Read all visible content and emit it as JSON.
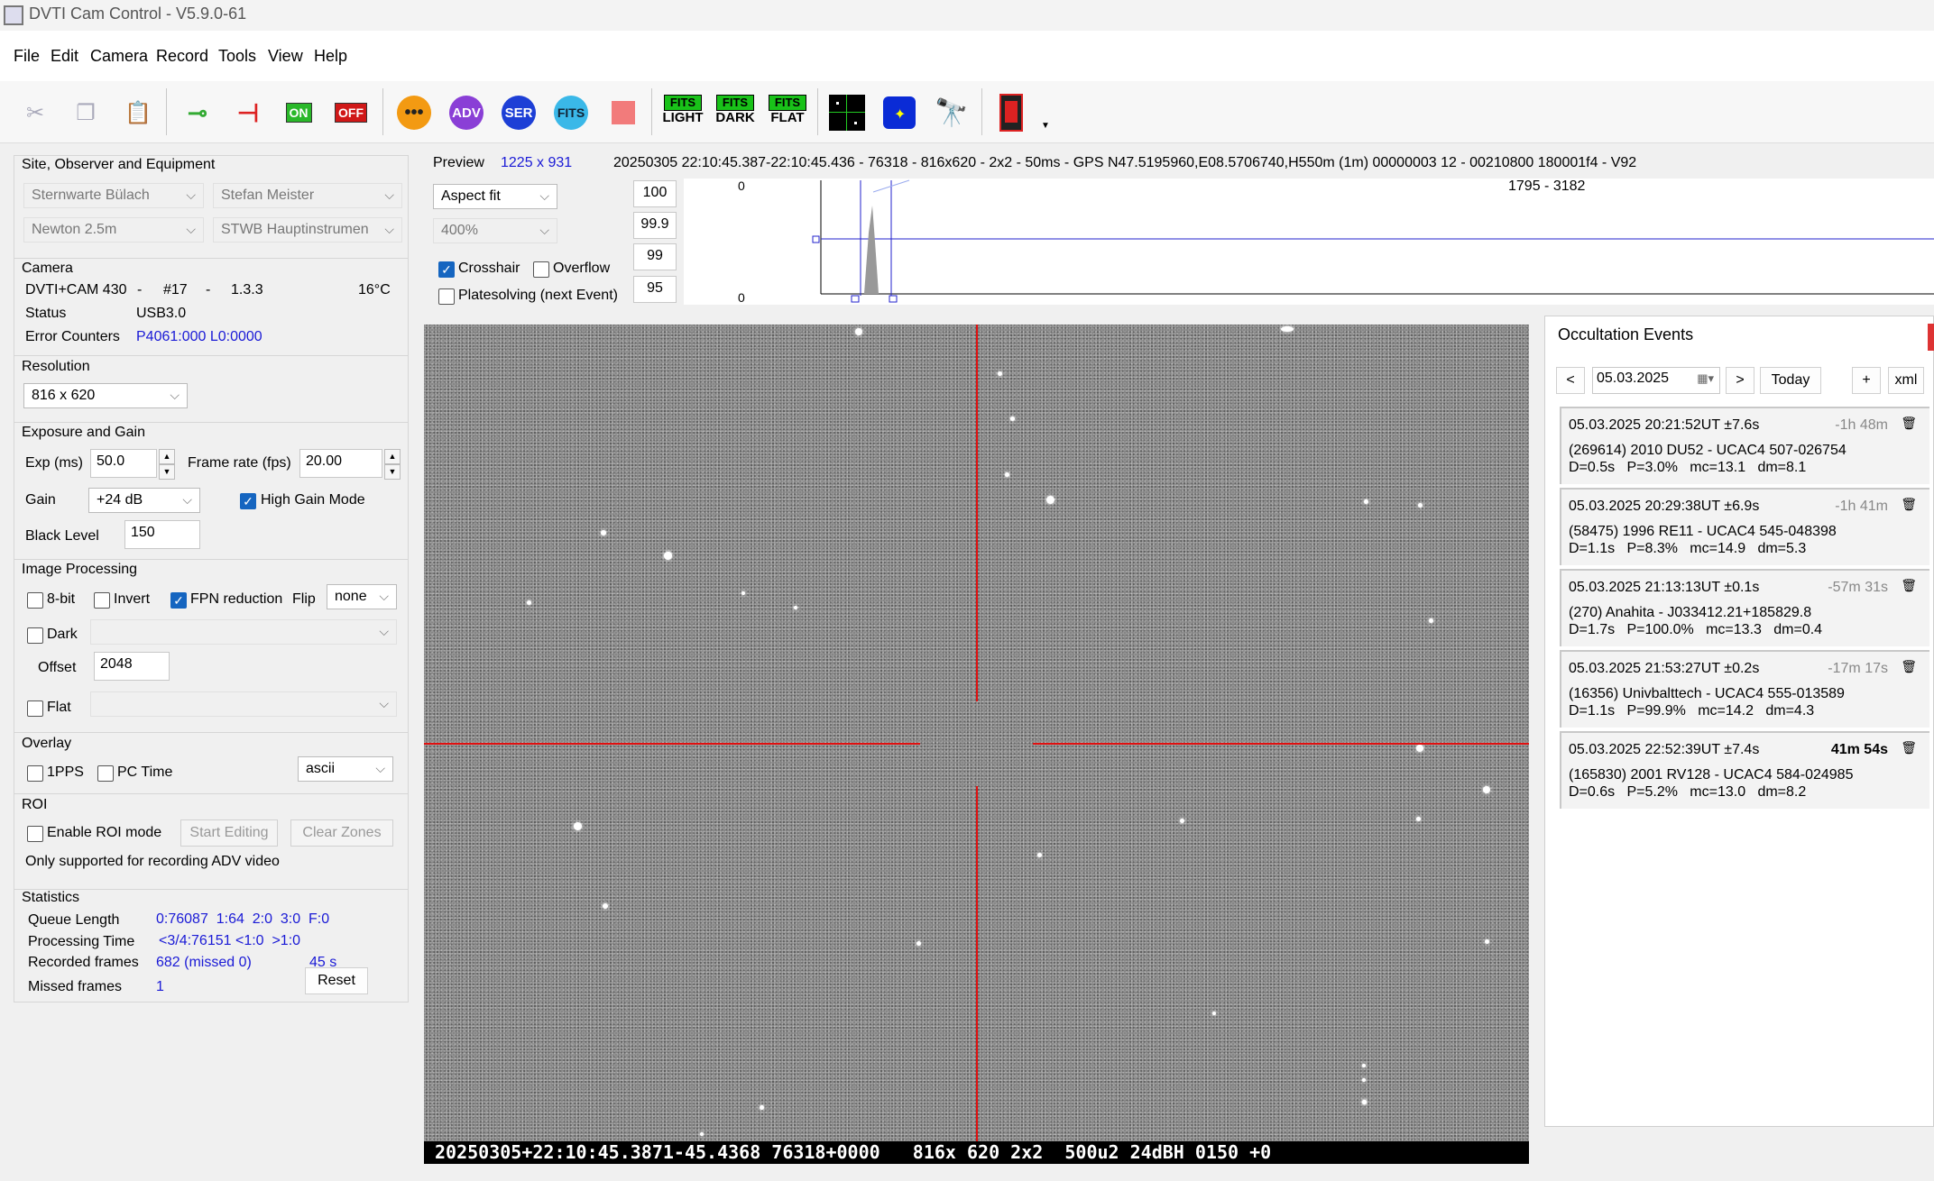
{
  "window": {
    "title": "DVTI Cam Control - V5.9.0-61"
  },
  "menu": [
    "File",
    "Edit",
    "Camera",
    "Record",
    "Tools",
    "View",
    "Help"
  ],
  "toolbar": {
    "on_label": "ON",
    "off_label": "OFF",
    "adv_label": "ADV",
    "ser_label": "SER",
    "fits_label": "FITS",
    "fits_light": "LIGHT",
    "fits_dark": "DARK",
    "fits_flat": "FLAT",
    "fits_badge": "FITS"
  },
  "site": {
    "title": "Site, Observer and Equipment",
    "site": "Sternwarte Bülach",
    "observer": "Stefan Meister",
    "telescope": "Newton 2.5m",
    "instrument": "STWB Hauptinstrumen"
  },
  "camera": {
    "title": "Camera",
    "model": "DVTI+CAM 430",
    "sep1": "-",
    "number": "#17",
    "sep2": "-",
    "version": "1.3.3",
    "temp": "16°C",
    "status_label": "Status",
    "status_value": "USB3.0",
    "errors_label": "Error Counters",
    "errors_value": "P4061:000 L0:0000"
  },
  "resolution": {
    "title": "Resolution",
    "value": "816 x 620"
  },
  "exposure": {
    "title": "Exposure and Gain",
    "exp_label": "Exp (ms)",
    "exp_value": "50.0",
    "fps_label": "Frame rate (fps)",
    "fps_value": "20.00",
    "gain_label": "Gain",
    "gain_value": "+24 dB",
    "high_gain_label": "High Gain Mode",
    "black_label": "Black Level",
    "black_value": "150"
  },
  "processing": {
    "title": "Image Processing",
    "bit8": "8-bit",
    "invert": "Invert",
    "fpn": "FPN reduction",
    "flip_label": "Flip",
    "flip_value": "none",
    "dark": "Dark",
    "offset_label": "Offset",
    "offset_value": "2048",
    "flat": "Flat"
  },
  "overlay": {
    "title": "Overlay",
    "pps": "1PPS",
    "pctime": "PC Time",
    "mode": "ascii"
  },
  "roi": {
    "title": "ROI",
    "enable": "Enable ROI mode",
    "start": "Start Editing",
    "clear": "Clear Zones",
    "note": "Only supported for recording ADV video"
  },
  "stats": {
    "title": "Statistics",
    "queue_label": "Queue Length",
    "queue_value": "0:76087  1:64  2:0  3:0  F:0",
    "proc_label": "Processing Time",
    "proc_value": "<3/4:76151 <1:0  >1:0",
    "rec_label": "Recorded frames",
    "rec_value": "682 (missed 0)",
    "rec_time": "45 s",
    "missed_label": "Missed frames",
    "missed_value": "1",
    "reset": "Reset"
  },
  "preview": {
    "label": "Preview",
    "size": "1225 x 931",
    "info": "20250305 22:10:45.387-22:10:45.436 - 76318 - 816x620 - 2x2 - 50ms - GPS N47.5195960,E08.5706740,H550m (1m) 00000003 12 - 00210800 180001f4 - V92",
    "fit": "Aspect fit",
    "zoom": "400%",
    "crosshair": "Crosshair",
    "overflow": "Overflow",
    "platesolving": "Platesolving (next Event)",
    "vals": [
      "100",
      "99.9",
      "99",
      "95"
    ],
    "histo_top": "0",
    "histo_bottom": "0",
    "histo_range": "1795 - 3182"
  },
  "overlay_text": "20250305+22:10:45.3871-45.4368 76318+0000   816x 620 2x2  500u2 24dBH 0150 +0",
  "occultation": {
    "title": "Occultation Events",
    "prev": "<",
    "date": "05.03.2025",
    "next": ">",
    "today": "Today",
    "add": "+",
    "xml": "xml",
    "events": [
      {
        "time": "05.03.2025 20:21:52UT ±7.6s",
        "rel": "-1h 48m",
        "obj": "(269614) 2010 DU52 - UCAC4 507-026754",
        "params": "D=0.5s   P=3.0%   mc=13.1   dm=8.1"
      },
      {
        "time": "05.03.2025 20:29:38UT ±6.9s",
        "rel": "-1h 41m",
        "obj": "(58475) 1996 RE11 - UCAC4 545-048398",
        "params": "D=1.1s   P=8.3%   mc=14.9   dm=5.3"
      },
      {
        "time": "05.03.2025 21:13:13UT ±0.1s",
        "rel": "-57m 31s",
        "obj": "(270) Anahita - J033412.21+185829.8",
        "params": "D=1.7s   P=100.0%   mc=13.3   dm=0.4"
      },
      {
        "time": "05.03.2025 21:53:27UT ±0.2s",
        "rel": "-17m 17s",
        "obj": "(16356) Univbalttech - UCAC4 555-013589",
        "params": "D=1.1s   P=99.9%   mc=14.2   dm=4.3"
      },
      {
        "time": "05.03.2025 22:52:39UT ±7.4s",
        "rel": "41m 54s",
        "obj": "(165830) 2001 RV128 - UCAC4 584-024985",
        "params": "D=0.6s   P=5.2%   mc=13.0   dm=8.2"
      }
    ]
  }
}
